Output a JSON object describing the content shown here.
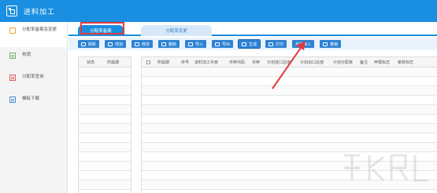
{
  "app": {
    "title": "进料加工"
  },
  "sidebar": {
    "items": [
      {
        "label": "分配率备案及变更",
        "icon": "card-icon",
        "active": true
      },
      {
        "label": "核销",
        "icon": "ledger-icon",
        "active": false
      },
      {
        "label": "分配率查询",
        "icon": "query-doc-icon",
        "active": false
      },
      {
        "label": "模板下载",
        "icon": "template-icon",
        "active": false
      }
    ]
  },
  "tabs": [
    {
      "label": "分配率备案",
      "active": true
    },
    {
      "label": "分配率变更",
      "active": false
    }
  ],
  "toolbar": {
    "refresh": "刷新",
    "add": "增加",
    "edit": "修改",
    "delete": "删除",
    "import": "导入",
    "export": "导出",
    "generate": "生成",
    "print": "打印",
    "feedback_import": "反馈读入",
    "withdraw": "撤销"
  },
  "left_table": {
    "columns": [
      "状态",
      "所属期"
    ]
  },
  "right_table": {
    "columns": [
      "所属期",
      "序号",
      "进料加工手册",
      "币种代码",
      "币种",
      "计划进口总值",
      "计划出口总值",
      "计划分配率",
      "备注",
      "申报标志",
      "审核标志"
    ]
  },
  "colors": {
    "accent": "#1a8ee0",
    "toolbar_bg": "#eaf3fc",
    "highlight": "#e0393e"
  }
}
